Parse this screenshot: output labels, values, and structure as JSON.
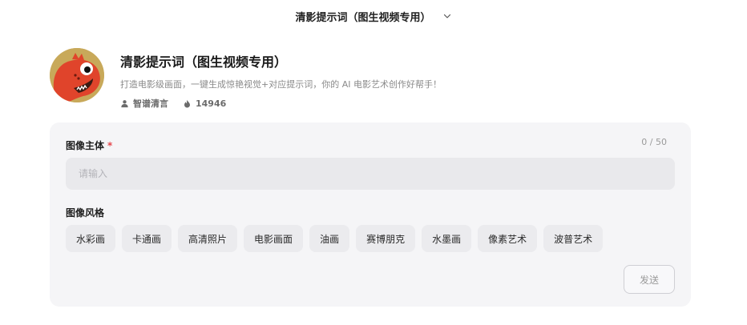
{
  "topbar": {
    "title": "清影提示词（图生视频专用）",
    "dropdown_icon": "chevron-down-icon"
  },
  "bot": {
    "name": "清影提示词（图生视频专用）",
    "description": "打造电影级画面，一键生成惊艳视觉+对应提示词，你的 AI 电影艺术创作好帮手！",
    "author": "智谱清言",
    "author_icon": "user-icon",
    "popularity": "14946",
    "popularity_icon": "flame-icon",
    "avatar_colors": {
      "background": "#c8a95a",
      "creature": "#e0442b"
    }
  },
  "form": {
    "subject_label": "图像主体",
    "required_mark": "*",
    "counter": "0 / 50",
    "subject_placeholder": "请输入",
    "subject_value": "",
    "style_label": "图像风格",
    "styles": [
      "水彩画",
      "卡通画",
      "高清照片",
      "电影画面",
      "油画",
      "赛博朋克",
      "水墨画",
      "像素艺术",
      "波普艺术"
    ],
    "send_label": "发送"
  },
  "colors": {
    "card_bg": "#f5f5f7",
    "chip_bg": "#ebebee",
    "required": "#e5484d"
  }
}
